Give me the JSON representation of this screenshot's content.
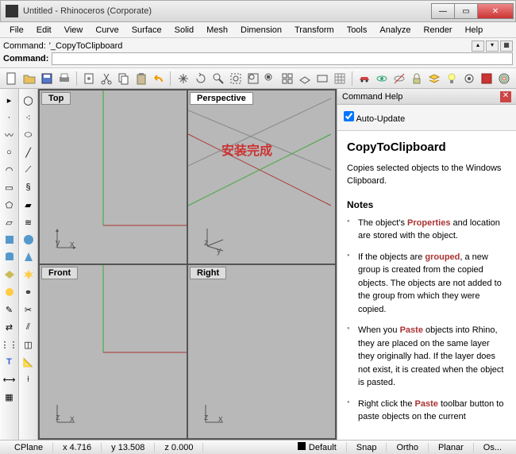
{
  "window": {
    "title": "Untitled - Rhinoceros (Corporate)"
  },
  "menu": [
    "File",
    "Edit",
    "View",
    "Curve",
    "Surface",
    "Solid",
    "Mesh",
    "Dimension",
    "Transform",
    "Tools",
    "Analyze",
    "Render",
    "Help"
  ],
  "command": {
    "prev_label": "Command:",
    "prev_value": "'_CopyToClipboard",
    "label": "Command:"
  },
  "viewports": {
    "top": "Top",
    "perspective": "Perspective",
    "front": "Front",
    "right": "Right",
    "overlay": "安装完成",
    "axis_top_v": "y",
    "axis_top_h": "x",
    "axis_persp_v": "z",
    "axis_persp_h": "y",
    "axis_persp_h2": "x",
    "axis_front_v": "z",
    "axis_front_h": "x",
    "axis_right_v": "z",
    "axis_right_h": "x"
  },
  "help": {
    "panel_title": "Command Help",
    "auto_update": "Auto-Update",
    "title": "CopyToClipboard",
    "desc": "Copies selected objects to the Windows Clipboard.",
    "notes_label": "Notes",
    "n1a": "The object's ",
    "n1b": "Properties",
    "n1c": " and location are stored with the object.",
    "n2a": "If the objects are ",
    "n2b": "grouped",
    "n2c": ", a new group is created from the copied objects. The objects are not added to the group from which they were copied.",
    "n3a": "When you ",
    "n3b": "Paste",
    "n3c": " objects into Rhino, they are placed on the same layer they originally had. If the layer does not exist, it is created when the object is pasted.",
    "n4a": "Right click the ",
    "n4b": "Paste",
    "n4c": " toolbar button to paste objects on the current"
  },
  "status": {
    "cplane": "CPlane",
    "x": "x 4.716",
    "y": "y 13.508",
    "z": "z 0.000",
    "layer": "Default",
    "snap": "Snap",
    "ortho": "Ortho",
    "planar": "Planar",
    "os": "Os..."
  }
}
